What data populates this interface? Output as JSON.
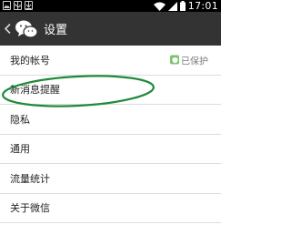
{
  "status_bar": {
    "time": "17:01",
    "notification_icons": [
      "picture-icon",
      "usb-icon",
      "download-icon"
    ],
    "indicator_icons": [
      "wifi-icon",
      "signal-icon",
      "battery-icon"
    ]
  },
  "title_bar": {
    "title": "设置",
    "logo": "wechat-logo-icon",
    "back_icon": "chevron-left-icon"
  },
  "settings": [
    {
      "label": "我的帐号",
      "status": "已保护"
    },
    {
      "label": "新消息提醒"
    },
    {
      "label": "隐私"
    },
    {
      "label": "通用"
    },
    {
      "label": "流量统计"
    },
    {
      "label": "关于微信"
    }
  ],
  "annotation": {
    "highlight_item": "新消息提醒",
    "color": "#1e8a3a"
  },
  "colors": {
    "title_bar": "#333334",
    "status_bar": "#000000",
    "protect": "#7cc36b"
  }
}
